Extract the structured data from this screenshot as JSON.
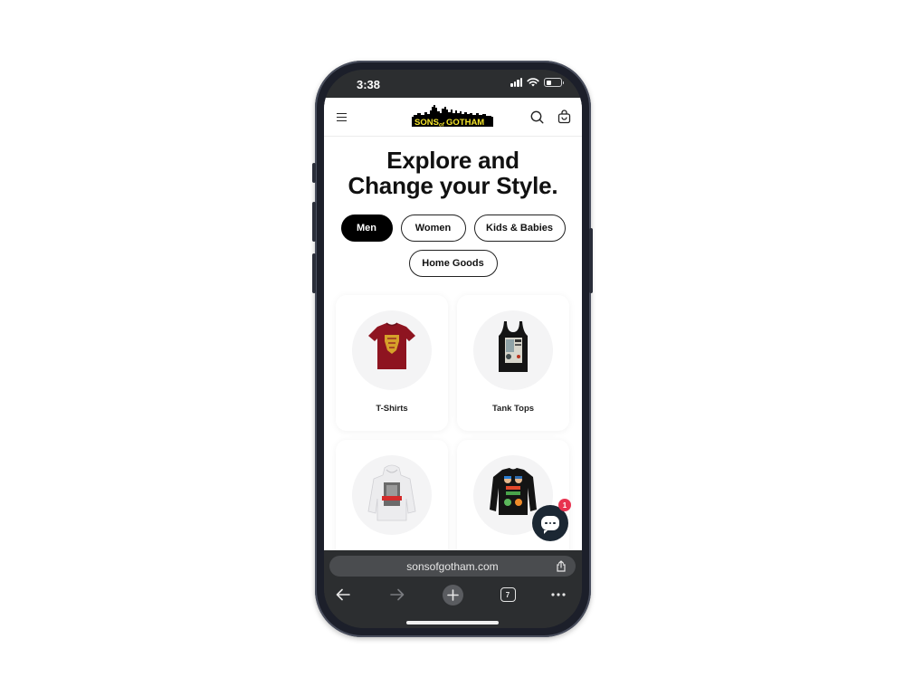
{
  "status_bar": {
    "time": "3:38",
    "icons": [
      "cellular-signal-icon",
      "wifi-icon",
      "battery-icon"
    ]
  },
  "site_header": {
    "menu_icon": "hamburger-menu-icon",
    "logo_text_left": "SONS",
    "logo_text_mid": "of",
    "logo_text_right": "GOTHAM",
    "search_icon": "search-icon",
    "cart_icon": "shopping-bag-icon",
    "logo_colors": {
      "text": "#f5e52a",
      "skyline": "#000000"
    }
  },
  "hero": {
    "line1": "Explore and",
    "line2": "Change your Style."
  },
  "category_tabs": [
    {
      "label": "Men",
      "active": true
    },
    {
      "label": "Women",
      "active": false
    },
    {
      "label": "Kids & Babies",
      "active": false
    },
    {
      "label": "Home Goods",
      "active": false
    }
  ],
  "product_categories": [
    {
      "label": "T-Shirts",
      "image": "red-tshirt-crest"
    },
    {
      "label": "Tank Tops",
      "image": "black-tank-top-poster"
    },
    {
      "label": "",
      "image": "white-hoodie-sesame"
    },
    {
      "label": "",
      "image": "black-sweatshirt-south-park"
    }
  ],
  "chat": {
    "icon": "chat-bubble-icon",
    "badge_count": "1",
    "badge_color": "#e8324f"
  },
  "browser": {
    "url": "sonsofgotham.com",
    "share_icon": "share-icon",
    "nav": {
      "back_icon": "back-arrow-icon",
      "forward_icon": "forward-arrow-icon",
      "new_tab_icon": "plus-icon",
      "tab_count": "7",
      "more_icon": "more-dots-icon"
    }
  }
}
